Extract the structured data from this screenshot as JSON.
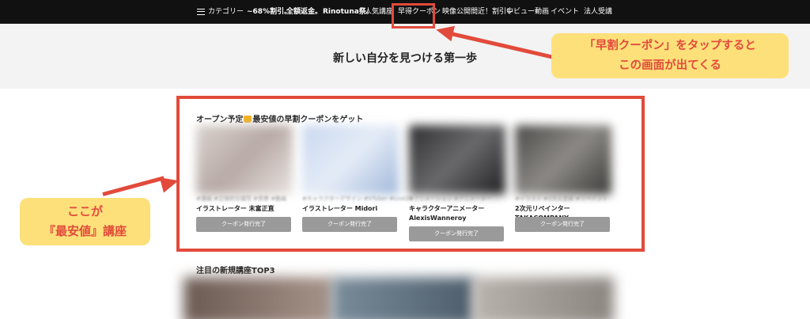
{
  "nav": {
    "category": "カテゴリー",
    "items": [
      "~68%割引。",
      "全額返金。",
      "Rinotuna祭。",
      "人気講座",
      "早得クーポン",
      "映像公開間近！割引中",
      "レビュー動画",
      "イベント",
      "法人受講"
    ]
  },
  "hero": {
    "title": "新しい自分を見つける第一歩"
  },
  "section1": {
    "title_before": "オープン予定",
    "title_after": "最安値の早割クーポンをゲット",
    "cards": [
      {
        "tags": "#漫画 #立体的な描写 #背景 #動画",
        "name": "イラストレーター 末富正直",
        "button": "クーポン発行完了"
      },
      {
        "tags": "#キャラクターデザイン #VTuber #Live2D",
        "name": "イラストレーター Midori",
        "button": "クーポン発行完了"
      },
      {
        "tags": "#アニメーション #アニメーター",
        "name": "キャラクターアニメーター AlexisWanneroy",
        "button": "クーポン発行完了"
      },
      {
        "tags": "#イラスト #2次元塗装 #リペイント",
        "name": "2次元リペインター TAKACOMPANY",
        "button": "クーポン発行完了"
      }
    ]
  },
  "section2": {
    "title": "注目の新規講座TOP3"
  },
  "annotations": {
    "callout_top": [
      "「早割クーポン」をタップすると",
      "この画面が出てくる"
    ],
    "callout_left": [
      "ここが",
      "『最安値』講座"
    ]
  },
  "colors": {
    "accent": "#e24a3b",
    "callout_bg": "#fde07a",
    "nav_bg": "#111111",
    "button_gray": "#9a9a9a"
  },
  "icons": {
    "menu": "hamburger-icon",
    "crown": "crown-icon"
  }
}
